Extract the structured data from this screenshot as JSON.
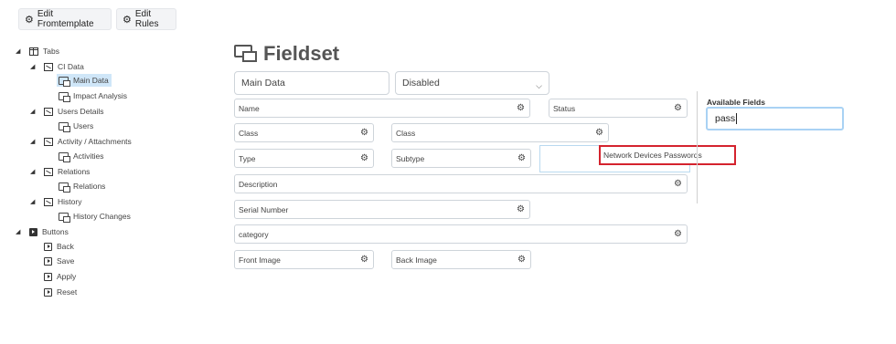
{
  "toolbar": {
    "edit_formtemplate": "Edit Fromtemplate",
    "edit_rules": "Edit Rules"
  },
  "tree": {
    "tabs": "Tabs",
    "ci_data": "CI Data",
    "main_data": "Main Data",
    "impact_analysis": "Impact Analysis",
    "users_details": "Users Details",
    "users": "Users",
    "activity_attachments": "Activity / Attachments",
    "activities": "Activities",
    "relations_group": "Relations",
    "relations": "Relations",
    "history_group": "History",
    "history_changes": "History Changes",
    "buttons": "Buttons",
    "back": "Back",
    "save": "Save",
    "apply": "Apply",
    "reset": "Reset"
  },
  "fieldset": {
    "title": "Fieldset",
    "name_value": "Main Data",
    "state_value": "Disabled"
  },
  "fields": {
    "name": "Name",
    "status": "Status",
    "class_1": "Class",
    "class_2": "Class",
    "type": "Type",
    "subtype": "Subtype",
    "description": "Description",
    "serial_number": "Serial Number",
    "category": "category",
    "front_image": "Front Image",
    "back_image": "Back Image"
  },
  "available": {
    "label": "Available Fields",
    "search_value": "pass",
    "dragged_item": "Network Devices Passwords"
  },
  "colors": {
    "highlight_border": "#d4232e",
    "selected_bg": "#cfe6f8",
    "search_border": "#a9d2f4"
  },
  "icons": {
    "gear": "gear-icon",
    "gears": "gears-icon",
    "caret": "caret-down-icon",
    "chevron": "chevron-down-icon"
  }
}
